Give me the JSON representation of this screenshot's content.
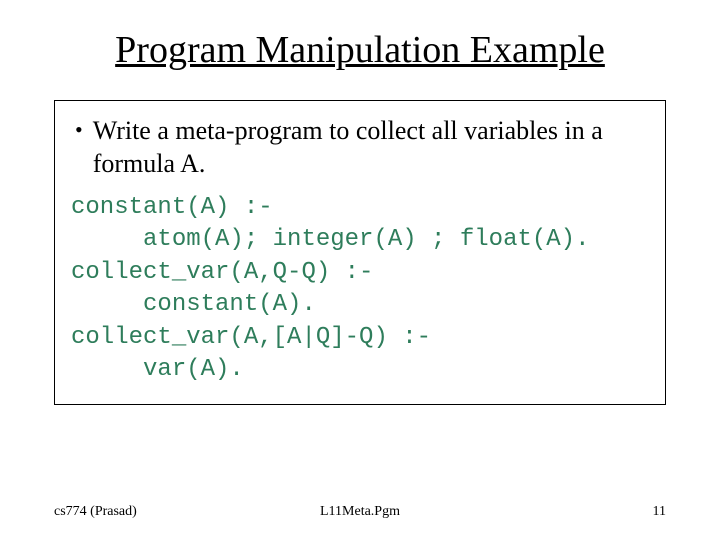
{
  "title": "Program Manipulation Example",
  "bullet": {
    "marker": "•",
    "text": "Write a meta-program to collect all variables in a formula A."
  },
  "code": {
    "l1": "constant(A) :-",
    "l2": "     atom(A); integer(A) ; float(A).",
    "l3": "collect_var(A,Q-Q) :-",
    "l4": "     constant(A).",
    "l5": "collect_var(A,[A|Q]-Q) :-",
    "l6": "     var(A)."
  },
  "footer": {
    "left": "cs774 (Prasad)",
    "center": "L11Meta.Pgm",
    "right": "11"
  }
}
